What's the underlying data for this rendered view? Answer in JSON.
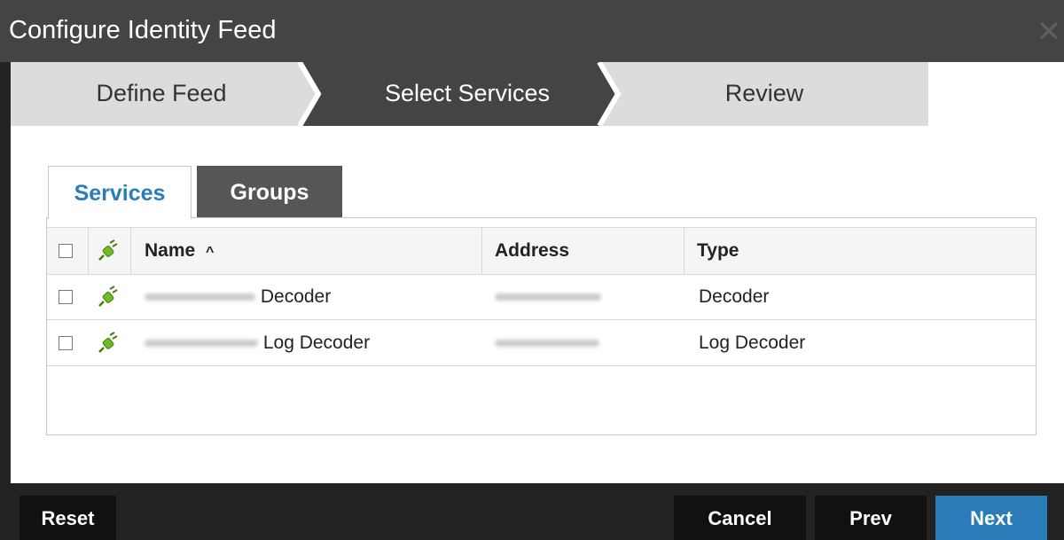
{
  "dialog": {
    "title": "Configure Identity Feed",
    "close_icon": "close-icon"
  },
  "wizard": {
    "steps": [
      {
        "label": "Define Feed",
        "state": "completed"
      },
      {
        "label": "Select Services",
        "state": "active"
      },
      {
        "label": "Review",
        "state": "pending"
      }
    ]
  },
  "tabs": [
    {
      "label": "Services",
      "selected": true
    },
    {
      "label": "Groups",
      "selected": false
    }
  ],
  "table": {
    "columns": {
      "select": "",
      "status": "plug-icon",
      "name": "Name",
      "name_sort": "^",
      "address": "Address",
      "type": "Type"
    },
    "rows": [
      {
        "name": "Decoder",
        "type": "Decoder"
      },
      {
        "name": "Log Decoder",
        "type": "Log Decoder"
      }
    ]
  },
  "footer": {
    "reset": "Reset",
    "cancel": "Cancel",
    "prev": "Prev",
    "next": "Next"
  },
  "colors": {
    "accent": "#2a7db8",
    "step_active": "#444444",
    "step_inactive": "#dcdcdc",
    "plug_green": "#6cbd24"
  }
}
